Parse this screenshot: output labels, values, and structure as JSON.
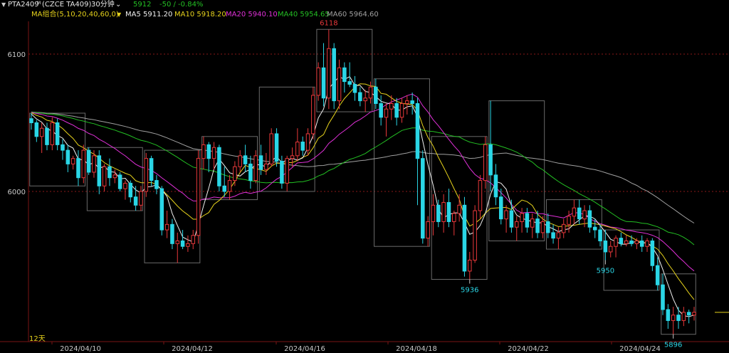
{
  "header": {
    "symbol": "PTA2409",
    "superscript": "M",
    "contract": "(CZCE TA409)",
    "period": "30分钟",
    "price": "5912",
    "change": "-50 / -0.84%"
  },
  "indicators": {
    "group_label": "MA组合(5,10,20,40,60,0)",
    "ma5": "MA5 5911.20",
    "ma10": "MA10 5918.20",
    "ma20": "MA20 5940.10",
    "ma40": "MA40 5954.65",
    "ma60": "MA60 5964.60"
  },
  "colors": {
    "up": "#e8383a",
    "down": "#2ad6e6",
    "ma5": "#f0f0f0",
    "ma10": "#e6d21c",
    "ma20": "#e030d8",
    "ma40": "#23bf23",
    "ma60": "#a0a0a0",
    "price_green": "#23c023",
    "grid": "#8a1818"
  },
  "footer": {
    "span_label": "12天"
  },
  "chart_data": {
    "type": "candlestick",
    "yticks": [
      6000,
      6100
    ],
    "ylim": [
      5887,
      6135
    ],
    "xticks": [
      "2024/04/10",
      "2024/04/12",
      "2024/04/16",
      "2024/04/18",
      "2024/04/22",
      "2024/04/24"
    ],
    "grid": "dotted horizontal at 6000 and 6100",
    "price_labels": [
      "6118",
      "5950",
      "5936",
      "5896"
    ],
    "ohlc": [
      [
        6053,
        6057,
        6045,
        6050
      ],
      [
        6050,
        6052,
        6036,
        6040
      ],
      [
        6040,
        6050,
        6028,
        6046
      ],
      [
        6046,
        6050,
        6030,
        6034
      ],
      [
        6034,
        6054,
        6030,
        6050
      ],
      [
        6050,
        6053,
        6030,
        6034
      ],
      [
        6034,
        6038,
        6023,
        6030
      ],
      [
        6030,
        6034,
        6014,
        6020
      ],
      [
        6020,
        6026,
        6016,
        6024
      ],
      [
        6024,
        6030,
        6004,
        6010
      ],
      [
        6010,
        6034,
        6006,
        6030
      ],
      [
        6030,
        6032,
        6012,
        6014
      ],
      [
        6014,
        6030,
        6010,
        6026
      ],
      [
        6026,
        6030,
        5998,
        6004
      ],
      [
        6004,
        6020,
        6000,
        6018
      ],
      [
        6018,
        6024,
        6004,
        6010
      ],
      [
        6010,
        6016,
        6006,
        6012
      ],
      [
        6012,
        6014,
        6000,
        6002
      ],
      [
        6002,
        6008,
        5994,
        6006
      ],
      [
        6006,
        6008,
        5992,
        5996
      ],
      [
        5996,
        6004,
        5986,
        5990
      ],
      [
        5990,
        6004,
        5986,
        6000
      ],
      [
        6000,
        6028,
        5996,
        6024
      ],
      [
        6024,
        6026,
        6004,
        6008
      ],
      [
        6008,
        6012,
        5998,
        6002
      ],
      [
        6002,
        6004,
        5968,
        5972
      ],
      [
        5972,
        5986,
        5966,
        5976
      ],
      [
        5976,
        5980,
        5958,
        5962
      ],
      [
        5962,
        5970,
        5948,
        5964
      ],
      [
        5964,
        5972,
        5958,
        5960
      ],
      [
        5960,
        5968,
        5956,
        5962
      ],
      [
        5962,
        5972,
        5958,
        5968
      ],
      [
        5968,
        6030,
        5962,
        6024
      ],
      [
        6024,
        6040,
        6016,
        6034
      ],
      [
        6034,
        6036,
        6014,
        6024
      ],
      [
        6024,
        6036,
        6016,
        6032
      ],
      [
        6032,
        6034,
        6000,
        6004
      ],
      [
        6004,
        6018,
        5996,
        6000
      ],
      [
        6000,
        6012,
        5994,
        6008
      ],
      [
        6008,
        6022,
        6004,
        6018
      ],
      [
        6018,
        6030,
        6014,
        6026
      ],
      [
        6026,
        6034,
        6014,
        6020
      ],
      [
        6020,
        6026,
        6002,
        6008
      ],
      [
        6008,
        6030,
        6006,
        6026
      ],
      [
        6026,
        6034,
        6012,
        6016
      ],
      [
        6016,
        6028,
        6012,
        6020
      ],
      [
        6020,
        6046,
        6018,
        6042
      ],
      [
        6042,
        6046,
        6018,
        6022
      ],
      [
        6022,
        6026,
        6002,
        6006
      ],
      [
        6006,
        6026,
        6000,
        6024
      ],
      [
        6024,
        6032,
        6018,
        6026
      ],
      [
        6026,
        6046,
        6022,
        6036
      ],
      [
        6036,
        6040,
        6026,
        6030
      ],
      [
        6030,
        6046,
        6026,
        6042
      ],
      [
        6042,
        6076,
        6038,
        6070
      ],
      [
        6070,
        6094,
        6066,
        6090
      ],
      [
        6090,
        6108,
        6062,
        6068
      ],
      [
        6068,
        6118,
        6060,
        6104
      ],
      [
        6104,
        6108,
        6060,
        6066
      ],
      [
        6066,
        6096,
        6060,
        6090
      ],
      [
        6090,
        6094,
        6072,
        6080
      ],
      [
        6080,
        6094,
        6076,
        6078
      ],
      [
        6078,
        6084,
        6066,
        6072
      ],
      [
        6072,
        6076,
        6062,
        6066
      ],
      [
        6066,
        6074,
        6058,
        6068
      ],
      [
        6068,
        6080,
        6064,
        6076
      ],
      [
        6076,
        6082,
        6060,
        6064
      ],
      [
        6064,
        6070,
        6048,
        6054
      ],
      [
        6054,
        6064,
        6040,
        6060
      ],
      [
        6060,
        6070,
        6052,
        6064
      ],
      [
        6064,
        6068,
        6048,
        6054
      ],
      [
        6054,
        6068,
        6050,
        6064
      ],
      [
        6064,
        6070,
        6056,
        6066
      ],
      [
        6066,
        6072,
        6056,
        6064
      ],
      [
        6064,
        6068,
        5990,
        6024
      ],
      [
        6024,
        6030,
        5962,
        5966
      ],
      [
        5966,
        5982,
        5960,
        5978
      ],
      [
        5978,
        5998,
        5968,
        5990
      ],
      [
        5990,
        5994,
        5974,
        5978
      ],
      [
        5978,
        5998,
        5970,
        5992
      ],
      [
        5992,
        6002,
        5974,
        5978
      ],
      [
        5978,
        5986,
        5968,
        5984
      ],
      [
        5984,
        5998,
        5978,
        5990
      ],
      [
        5990,
        5996,
        5938,
        5942
      ],
      [
        5942,
        5956,
        5936,
        5950
      ],
      [
        5950,
        5990,
        5948,
        5986
      ],
      [
        5986,
        6012,
        5980,
        6008
      ],
      [
        6008,
        6040,
        6002,
        6034
      ],
      [
        6034,
        6066,
        6000,
        6012
      ],
      [
        6012,
        6020,
        5990,
        5996
      ],
      [
        5996,
        6002,
        5976,
        5980
      ],
      [
        5980,
        5990,
        5970,
        5986
      ],
      [
        5986,
        5994,
        5970,
        5974
      ],
      [
        5974,
        5982,
        5964,
        5978
      ],
      [
        5978,
        5988,
        5970,
        5984
      ],
      [
        5984,
        5988,
        5970,
        5974
      ],
      [
        5974,
        5984,
        5966,
        5980
      ],
      [
        5980,
        5986,
        5966,
        5970
      ],
      [
        5970,
        5982,
        5966,
        5978
      ],
      [
        5978,
        5984,
        5966,
        5970
      ],
      [
        5970,
        5976,
        5962,
        5966
      ],
      [
        5966,
        5974,
        5958,
        5970
      ],
      [
        5970,
        5980,
        5966,
        5976
      ],
      [
        5976,
        5986,
        5970,
        5982
      ],
      [
        5982,
        5994,
        5976,
        5988
      ],
      [
        5988,
        5994,
        5976,
        5980
      ],
      [
        5980,
        5990,
        5974,
        5986
      ],
      [
        5986,
        5990,
        5970,
        5974
      ],
      [
        5974,
        5980,
        5966,
        5972
      ],
      [
        5972,
        5976,
        5960,
        5964
      ],
      [
        5964,
        5972,
        5950,
        5956
      ],
      [
        5956,
        5964,
        5952,
        5960
      ],
      [
        5960,
        5968,
        5952,
        5966
      ],
      [
        5966,
        5970,
        5960,
        5962
      ],
      [
        5962,
        5968,
        5960,
        5964
      ],
      [
        5964,
        5968,
        5960,
        5962
      ],
      [
        5962,
        5966,
        5958,
        5964
      ],
      [
        5964,
        5968,
        5956,
        5960
      ],
      [
        5960,
        5966,
        5956,
        5964
      ],
      [
        5964,
        5966,
        5942,
        5946
      ],
      [
        5946,
        5952,
        5928,
        5932
      ],
      [
        5932,
        5940,
        5910,
        5914
      ],
      [
        5914,
        5918,
        5900,
        5906
      ],
      [
        5906,
        5916,
        5896,
        5910
      ],
      [
        5910,
        5916,
        5900,
        5906
      ],
      [
        5906,
        5916,
        5902,
        5912
      ],
      [
        5912,
        5914,
        5904,
        5910
      ],
      [
        5910,
        5916,
        5906,
        5912
      ]
    ]
  }
}
